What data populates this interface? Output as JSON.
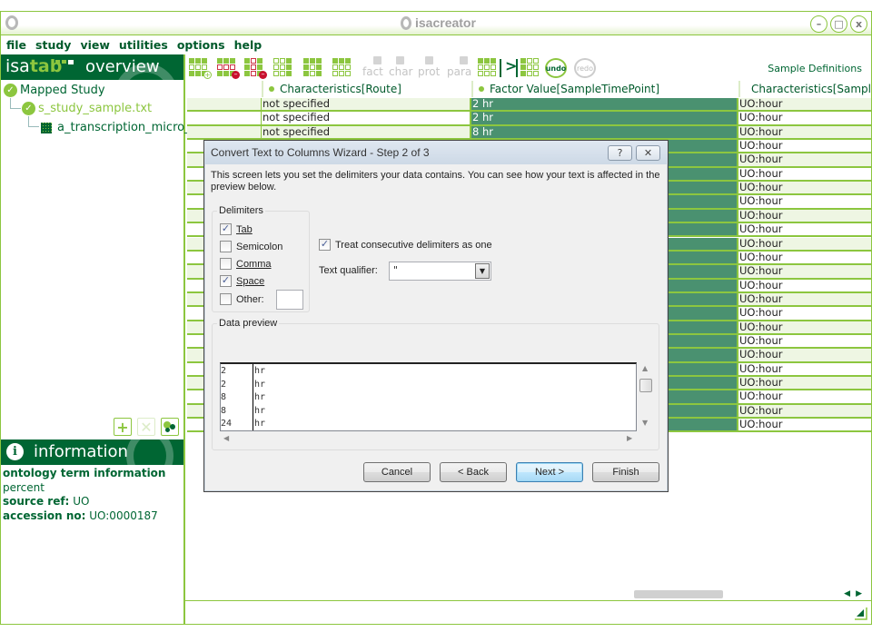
{
  "window": {
    "title": "isacreator",
    "controls": [
      "minimize",
      "maximize",
      "close"
    ]
  },
  "menu": [
    "file",
    "study",
    "view",
    "utilities",
    "options",
    "help"
  ],
  "overview": {
    "brand_prefix": "isa",
    "brand_suffix": "tab",
    "title": "overview"
  },
  "tree": [
    {
      "label": "Mapped Study",
      "icon": "check-circle-icon"
    },
    {
      "label": "s_study_sample.txt",
      "icon": "check-circle-icon"
    },
    {
      "label": "a_transcription_micro_",
      "icon": "assay-grid-icon"
    }
  ],
  "side_actions": [
    "add",
    "remove",
    "ontology"
  ],
  "information": {
    "title": "information",
    "heading": "ontology term information",
    "term": "percent",
    "source_ref_label": "source ref:",
    "source_ref": "UO",
    "accession_label": "accession no:",
    "accession": "UO:0000187"
  },
  "toolbar": {
    "words": [
      "fact",
      "char",
      "prot",
      "para"
    ],
    "undo": "undo",
    "redo": "redo",
    "section_label": "Sample Definitions"
  },
  "grid": {
    "columns": [
      "",
      "Characteristics[Route]",
      "Factor Value[SampleTimePoint]",
      "Characteristics[Sample"
    ],
    "rows": [
      [
        "",
        "not specified",
        "2 hr",
        "UO:hour"
      ],
      [
        "",
        "not specified",
        "2 hr",
        "UO:hour"
      ],
      [
        "",
        "not specified",
        "8 hr",
        "UO:hour"
      ],
      [
        "",
        "",
        "",
        "UO:hour"
      ],
      [
        "",
        "",
        "",
        "UO:hour"
      ],
      [
        "",
        "",
        "",
        "UO:hour"
      ],
      [
        "",
        "",
        "",
        "UO:hour"
      ],
      [
        "",
        "",
        "",
        "UO:hour"
      ],
      [
        "",
        "",
        "",
        "UO:hour"
      ],
      [
        "",
        "",
        "",
        "UO:hour"
      ],
      [
        "",
        "",
        "",
        "UO:hour"
      ],
      [
        "",
        "",
        "",
        "UO:hour"
      ],
      [
        "",
        "",
        "",
        "UO:hour"
      ],
      [
        "",
        "",
        "",
        "UO:hour"
      ],
      [
        "",
        "",
        "",
        "UO:hour"
      ],
      [
        "",
        "",
        "",
        "UO:hour"
      ],
      [
        "",
        "",
        "",
        "UO:hour"
      ],
      [
        "",
        "",
        "",
        "UO:hour"
      ],
      [
        "",
        "",
        "",
        "UO:hour"
      ],
      [
        "",
        "",
        "",
        "UO:hour"
      ],
      [
        "",
        "",
        "",
        "UO:hour"
      ],
      [
        "",
        "",
        "",
        "UO:hour"
      ],
      [
        "",
        "",
        "",
        "UO:hour"
      ],
      [
        "",
        "",
        "",
        "UO:hour"
      ]
    ]
  },
  "dialog": {
    "title": "Convert Text to Columns Wizard - Step 2 of 3",
    "help_button": "?",
    "close_button": "✕",
    "description": "This screen lets you set the delimiters your data contains.  You can see how your text is affected in the preview below.",
    "delimiters_label": "Delimiters",
    "delimiters": [
      {
        "label": "Tab",
        "checked": true
      },
      {
        "label": "Semicolon",
        "checked": false
      },
      {
        "label": "Comma",
        "checked": false
      },
      {
        "label": "Space",
        "checked": true
      },
      {
        "label": "Other:",
        "checked": false
      }
    ],
    "other_value": "",
    "treat_consecutive_label": "Treat consecutive delimiters as one",
    "treat_consecutive_checked": true,
    "text_qualifier_label": "Text qualifier:",
    "text_qualifier_value": "\"",
    "data_preview_label": "Data preview",
    "preview_rows": [
      [
        "2",
        "hr"
      ],
      [
        "2",
        "hr"
      ],
      [
        "8",
        "hr"
      ],
      [
        "8",
        "hr"
      ],
      [
        "24",
        "hr"
      ]
    ],
    "buttons": {
      "cancel": "Cancel",
      "back": "< Back",
      "next": "Next >",
      "finish": "Finish"
    }
  },
  "colors": {
    "brand_dark": "#006633",
    "brand_light": "#8cc63f",
    "factor_cell": "#4a9170"
  }
}
